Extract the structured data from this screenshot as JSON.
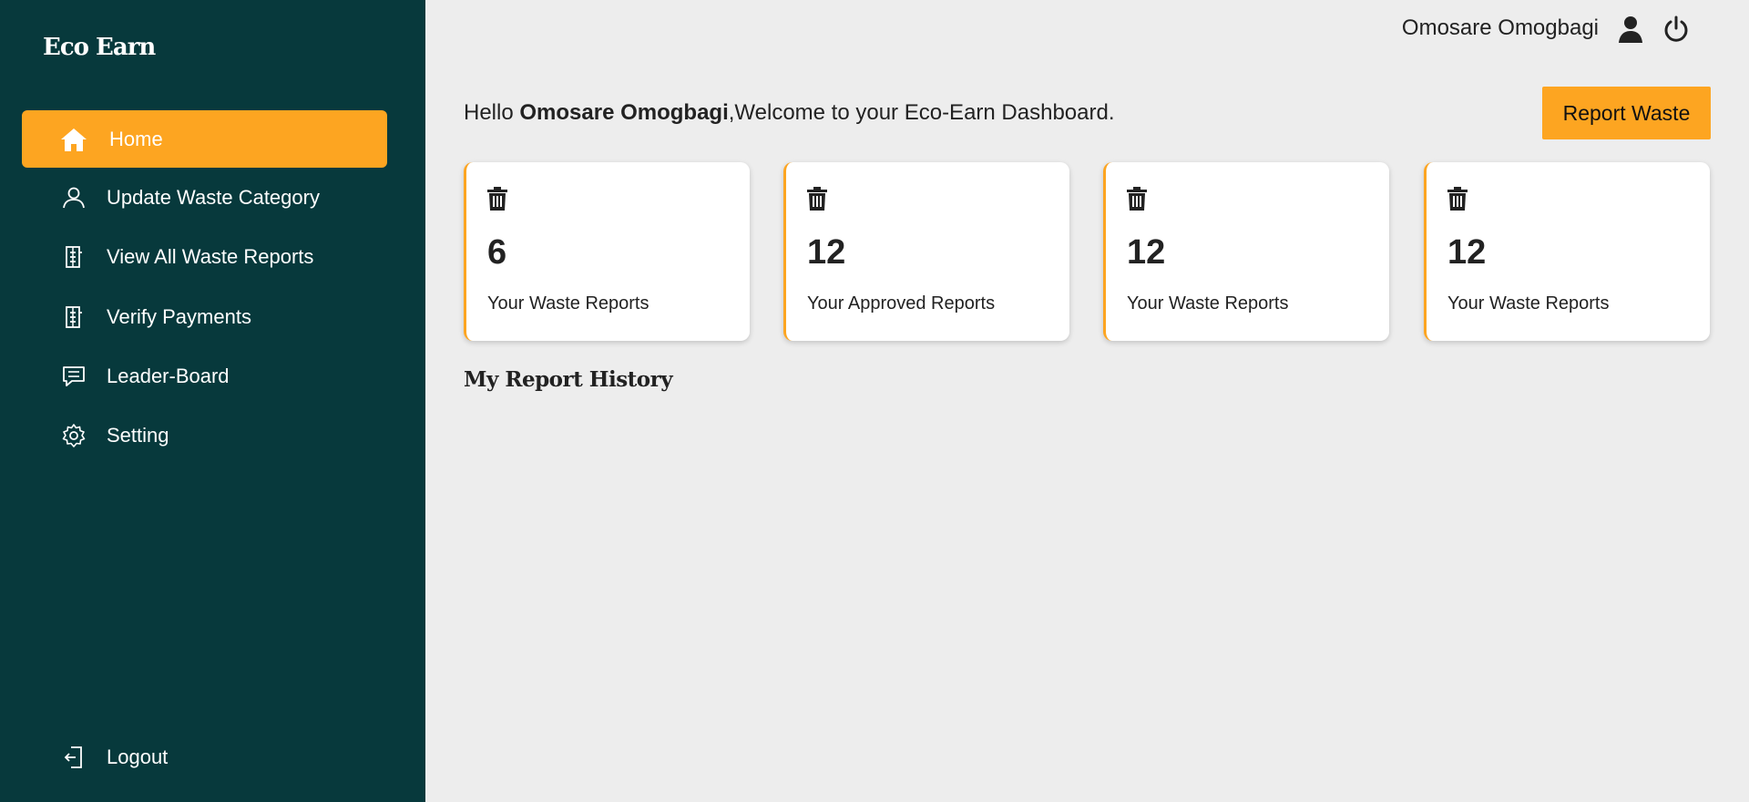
{
  "brand": "Eco Earn",
  "sidebar": {
    "items": [
      {
        "label": "Home",
        "icon": "home-icon",
        "active": true
      },
      {
        "label": "Update Waste Category",
        "icon": "user-icon"
      },
      {
        "label": "View All Waste Reports",
        "icon": "building-icon"
      },
      {
        "label": "Verify Payments",
        "icon": "building-icon"
      },
      {
        "label": "Leader-Board",
        "icon": "message-icon"
      },
      {
        "label": "Setting",
        "icon": "gear-icon"
      }
    ],
    "logout": {
      "label": "Logout",
      "icon": "logout-icon"
    }
  },
  "header": {
    "user_name": "Omosare Omogbagi"
  },
  "greeting": {
    "prefix": "Hello ",
    "name": "Omosare Omogbagi",
    "suffix": ",Welcome to your Eco-Earn Dashboard."
  },
  "report_button": "Report Waste",
  "cards": [
    {
      "value": "6",
      "label": "Your Waste Reports"
    },
    {
      "value": "12",
      "label": "Your Approved Reports"
    },
    {
      "value": "12",
      "label": "Your Waste Reports"
    },
    {
      "value": "12",
      "label": "Your Waste Reports"
    }
  ],
  "section_title": "My Report History",
  "colors": {
    "sidebar": "#07393c",
    "accent": "#fda521",
    "background": "#ededed"
  }
}
